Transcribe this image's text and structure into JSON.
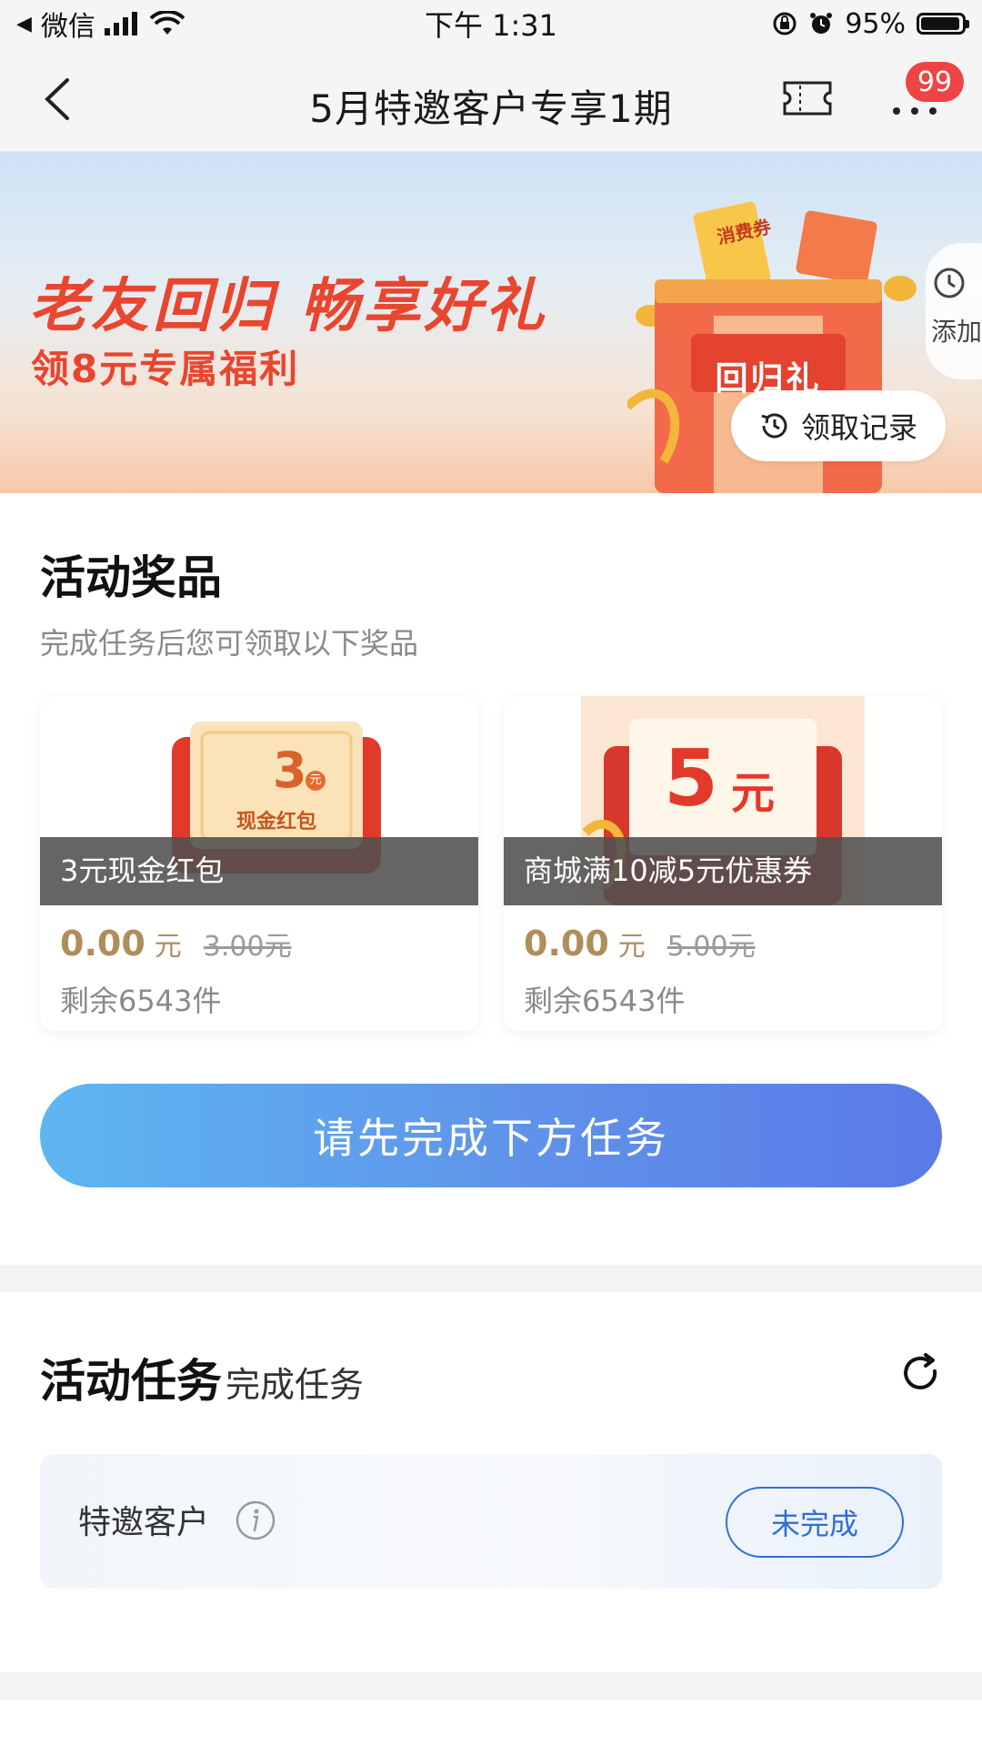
{
  "status_bar": {
    "back_app": "微信",
    "time": "下午 1:31",
    "battery": "95%",
    "battery_level": 0.95
  },
  "nav": {
    "title": "5月特邀客户专享1期",
    "badge_count": "99"
  },
  "banner": {
    "title": "老友回归 畅享好礼",
    "subtitle": "领8元专属福利",
    "gift_label": "回归礼",
    "ticket_label": "消费券",
    "record_button": "领取记录",
    "add_tab_label": "添加"
  },
  "prizes": {
    "title": "活动奖品",
    "subtitle": "完成任务后您可领取以下奖品",
    "items": [
      {
        "name": "3元现金红包",
        "price": "0.00",
        "unit": "元",
        "original_price": "3.00元",
        "stock": "剩余6543件",
        "img_amount": "3",
        "img_unit": "元",
        "img_label": "现金红包"
      },
      {
        "name": "商城满10减5元优惠券",
        "price": "0.00",
        "unit": "元",
        "original_price": "5.00元",
        "stock": "剩余6543件",
        "img_amount": "5",
        "img_unit": "元"
      }
    ]
  },
  "cta": {
    "label": "请先完成下方任务"
  },
  "tasks": {
    "title": "活动任务",
    "subtitle": "完成任务",
    "items": [
      {
        "label": "特邀客户",
        "status": "未完成"
      }
    ]
  },
  "colors": {
    "accent_red": "#e8462f",
    "price_gold": "#b08d5a",
    "cta_start": "#5eb6f1",
    "cta_end": "#5a7ae6",
    "status_blue": "#2f6fd6",
    "badge_red": "#ef4444"
  }
}
